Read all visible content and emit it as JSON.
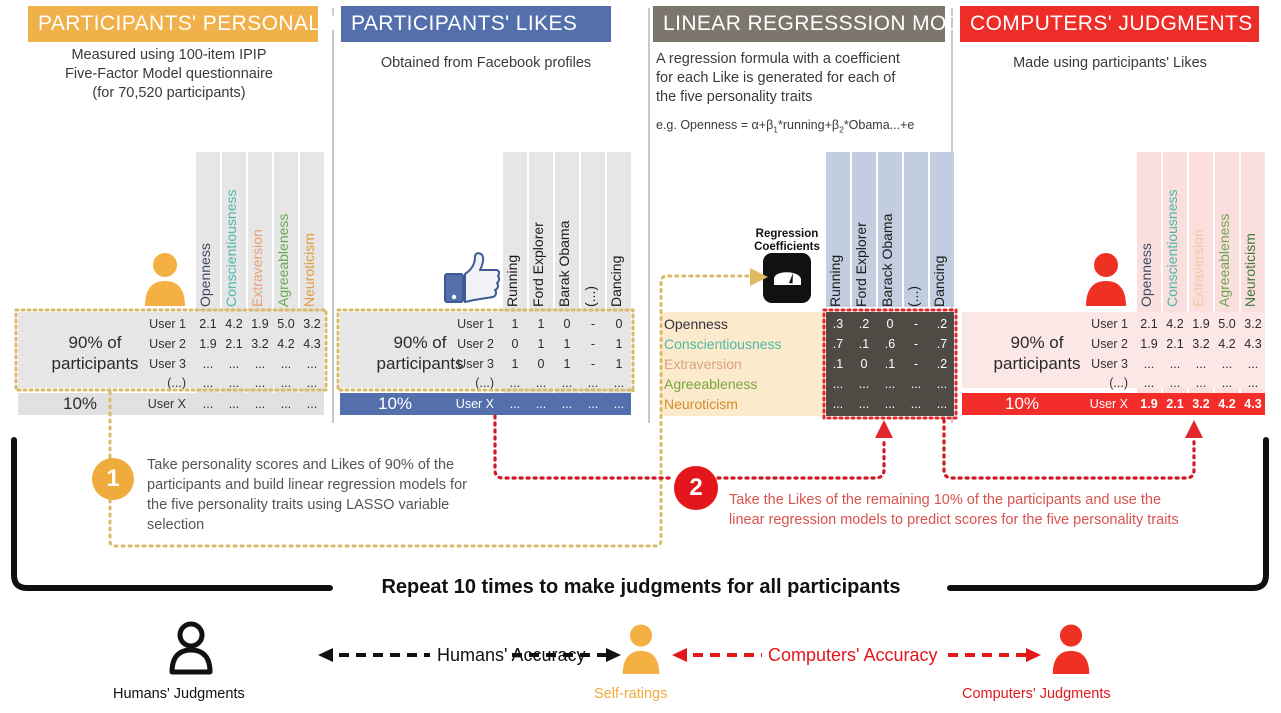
{
  "panels": [
    {
      "id": "participants-personality",
      "title": "PARTICIPANTS' PERSONALITY",
      "color": "#f0b04a",
      "subtitle": "Measured using 100-item IPIP\nFive-Factor Model questionnaire\n(for 70,520 participants)",
      "icon": "person-orange-icon",
      "columns": [
        "Openness",
        "Conscientiousness",
        "Extraversion",
        "Agreeableness",
        "Neuroticism"
      ],
      "column_colors": [
        "#3b4a63",
        "#4cb8a8",
        "#e8a07a",
        "#6aa84f",
        "#e09b3d"
      ],
      "group_label": "90% of\nparticipants",
      "minority_label": "10%",
      "rows": [
        {
          "label": "User 1",
          "values": [
            "2.1",
            "4.2",
            "1.9",
            "5.0",
            "3.2"
          ]
        },
        {
          "label": "User 2",
          "values": [
            "1.9",
            "2.1",
            "3.2",
            "4.2",
            "4.3"
          ]
        },
        {
          "label": "User 3",
          "values": [
            "...",
            "...",
            "...",
            "...",
            "..."
          ]
        },
        {
          "label": "(...)",
          "values": [
            "...",
            "...",
            "...",
            "...",
            "..."
          ]
        }
      ],
      "minority_row": {
        "label": "User X",
        "values": [
          "...",
          "...",
          "...",
          "...",
          "..."
        ]
      }
    },
    {
      "id": "participants-likes",
      "title": "PARTICIPANTS'  LIKES",
      "color": "#5370ad",
      "subtitle": "Obtained from Facebook profiles",
      "icon": "facebook-thumbs-up-icon",
      "columns": [
        "Running",
        "Ford Explorer",
        "Barak Obama",
        "(...)",
        "Dancing"
      ],
      "column_colors": [
        "#1b1b1b",
        "#1b1b1b",
        "#1b1b1b",
        "#1b1b1b",
        "#1b1b1b"
      ],
      "group_label": "90% of\nparticipants",
      "minority_label": "10%",
      "rows": [
        {
          "label": "User 1",
          "values": [
            "1",
            "1",
            "0",
            "-",
            "0"
          ]
        },
        {
          "label": "User 2",
          "values": [
            "0",
            "1",
            "1",
            "-",
            "1"
          ]
        },
        {
          "label": "User 3",
          "values": [
            "1",
            "0",
            "1",
            "-",
            "1"
          ]
        },
        {
          "label": "(...)",
          "values": [
            "...",
            "...",
            "...",
            "...",
            "..."
          ]
        }
      ],
      "minority_row": {
        "label": "User X",
        "values": [
          "...",
          "...",
          "...",
          "...",
          "..."
        ]
      }
    },
    {
      "id": "linear-regression-models",
      "title": "LINEAR REGRESSSION MODELS",
      "color": "#7d766c",
      "subtitle": "A regression formula with a coefficient\nfor each Like is generated for each of\nthe five personality traits",
      "formula_prefix": "e.g. Openness = α+β",
      "formula_sub1": "1",
      "formula_mid": "*running+β",
      "formula_sub2": "2",
      "formula_suffix": "*Obama...+e",
      "icon": "weight-scale-icon",
      "scale_label": "Regression\nCoefficients",
      "columns": [
        "Running",
        "Ford Explorer",
        "Barack Obama",
        "(...)",
        "Dancing"
      ],
      "traits": [
        "Openness",
        "Conscientiousness",
        "Extraversion",
        "Agreeableness",
        "Neuroticism"
      ],
      "trait_colors": [
        "#32323c",
        "#4cb8a8",
        "#d9a184",
        "#76a63d",
        "#d4892f"
      ],
      "rows": [
        {
          "label": "Openness",
          "values": [
            ".3",
            ".2",
            "0",
            "-",
            ".2"
          ]
        },
        {
          "label": "Conscientiousness",
          "values": [
            ".7",
            ".1",
            ".6",
            "-",
            ".7"
          ]
        },
        {
          "label": "Extraversion",
          "values": [
            ".1",
            "0",
            ".1",
            "-",
            ".2"
          ]
        },
        {
          "label": "Agreeableness",
          "values": [
            "...",
            "...",
            "...",
            "...",
            "..."
          ]
        },
        {
          "label": "Neuroticism",
          "values": [
            "...",
            "...",
            "...",
            "...",
            "..."
          ]
        }
      ]
    },
    {
      "id": "computers-judgments",
      "title": "COMPUTERS' JUDGMENTS",
      "color": "#ee2d28",
      "subtitle": "Made using  participants' Likes",
      "icon": "person-red-icon",
      "columns": [
        "Openness",
        "Conscientiousness",
        "Extraversion",
        "Agreeableness",
        "Neuroticism"
      ],
      "column_colors": [
        "#3b4a63",
        "#4cb8a8",
        "#eec9a0",
        "#6aa84f",
        "#3b7a3b"
      ],
      "group_label": "90% of\nparticipants",
      "minority_label": "10%",
      "rows": [
        {
          "label": "User 1",
          "values": [
            "2.1",
            "4.2",
            "1.9",
            "5.0",
            "3.2"
          ]
        },
        {
          "label": "User 2",
          "values": [
            "1.9",
            "2.1",
            "3.2",
            "4.2",
            "4.3"
          ]
        },
        {
          "label": "User 3",
          "values": [
            "...",
            "...",
            "...",
            "...",
            "..."
          ]
        },
        {
          "label": "(...)",
          "values": [
            "...",
            "...",
            "...",
            "...",
            "..."
          ]
        }
      ],
      "minority_row": {
        "label": "User X",
        "values": [
          "1.9",
          "2.1",
          "3.2",
          "4.2",
          "4.3"
        ]
      }
    }
  ],
  "steps": [
    {
      "number": "1",
      "color": "#f0ab3d",
      "text": "Take personality scores and Likes of 90% of the participants and build linear regression models for the five personality traits using LASSO variable selection"
    },
    {
      "number": "2",
      "color": "#e3161c",
      "text": "Take the Likes of the remaining 10% of the participants and use the linear regression models to predict scores for the five personality traits"
    }
  ],
  "repeat_label": "Repeat 10 times to make judgments for all participants",
  "footer": {
    "humans_accuracy": "Humans' Accuracy",
    "computers_accuracy": "Computers' Accuracy",
    "humans_judgments": "Humans' Judgments",
    "self_ratings": "Self-ratings",
    "computers_judgments": "Computers' Judgments",
    "humans_icon": "person-outline-icon",
    "self_icon": "person-orange-icon",
    "computers_icon": "person-red-icon",
    "humans_color": "#111111",
    "self_color": "#f0ab3d",
    "computers_color": "#e3161c"
  }
}
